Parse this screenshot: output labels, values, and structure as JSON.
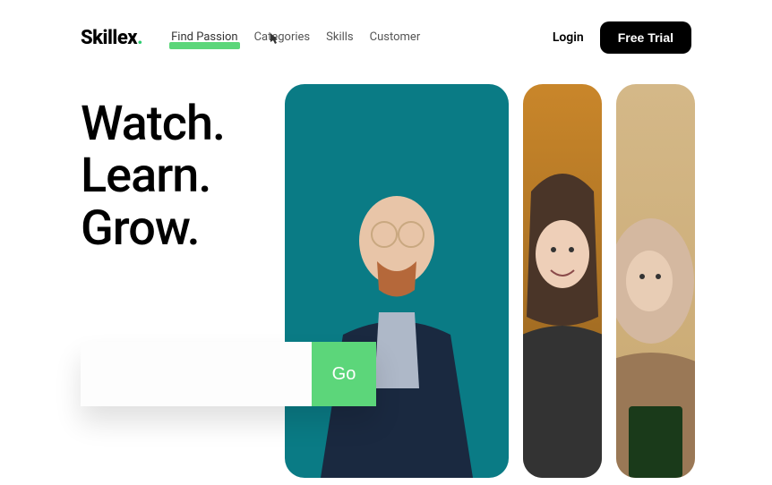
{
  "logo": {
    "text": "Skillex",
    "dot": "."
  },
  "nav": {
    "items": [
      {
        "label": "Find Passion",
        "active": true
      },
      {
        "label": "Categories"
      },
      {
        "label": "Skills"
      },
      {
        "label": "Customer"
      }
    ]
  },
  "header": {
    "login": "Login",
    "trial": "Free Trial"
  },
  "hero": {
    "line1": "Watch.",
    "line2": "Learn.",
    "line3": "Grow."
  },
  "search": {
    "placeholder": "",
    "button": "Go"
  }
}
